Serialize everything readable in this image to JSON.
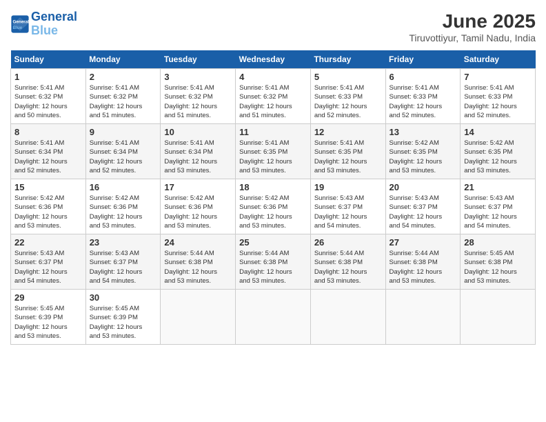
{
  "header": {
    "logo_line1": "General",
    "logo_line2": "Blue",
    "month_title": "June 2025",
    "location": "Tiruvottiyur, Tamil Nadu, India"
  },
  "weekdays": [
    "Sunday",
    "Monday",
    "Tuesday",
    "Wednesday",
    "Thursday",
    "Friday",
    "Saturday"
  ],
  "weeks": [
    [
      {
        "day": "1",
        "info": "Sunrise: 5:41 AM\nSunset: 6:32 PM\nDaylight: 12 hours\nand 50 minutes."
      },
      {
        "day": "2",
        "info": "Sunrise: 5:41 AM\nSunset: 6:32 PM\nDaylight: 12 hours\nand 51 minutes."
      },
      {
        "day": "3",
        "info": "Sunrise: 5:41 AM\nSunset: 6:32 PM\nDaylight: 12 hours\nand 51 minutes."
      },
      {
        "day": "4",
        "info": "Sunrise: 5:41 AM\nSunset: 6:32 PM\nDaylight: 12 hours\nand 51 minutes."
      },
      {
        "day": "5",
        "info": "Sunrise: 5:41 AM\nSunset: 6:33 PM\nDaylight: 12 hours\nand 52 minutes."
      },
      {
        "day": "6",
        "info": "Sunrise: 5:41 AM\nSunset: 6:33 PM\nDaylight: 12 hours\nand 52 minutes."
      },
      {
        "day": "7",
        "info": "Sunrise: 5:41 AM\nSunset: 6:33 PM\nDaylight: 12 hours\nand 52 minutes."
      }
    ],
    [
      {
        "day": "8",
        "info": "Sunrise: 5:41 AM\nSunset: 6:34 PM\nDaylight: 12 hours\nand 52 minutes."
      },
      {
        "day": "9",
        "info": "Sunrise: 5:41 AM\nSunset: 6:34 PM\nDaylight: 12 hours\nand 52 minutes."
      },
      {
        "day": "10",
        "info": "Sunrise: 5:41 AM\nSunset: 6:34 PM\nDaylight: 12 hours\nand 53 minutes."
      },
      {
        "day": "11",
        "info": "Sunrise: 5:41 AM\nSunset: 6:35 PM\nDaylight: 12 hours\nand 53 minutes."
      },
      {
        "day": "12",
        "info": "Sunrise: 5:41 AM\nSunset: 6:35 PM\nDaylight: 12 hours\nand 53 minutes."
      },
      {
        "day": "13",
        "info": "Sunrise: 5:42 AM\nSunset: 6:35 PM\nDaylight: 12 hours\nand 53 minutes."
      },
      {
        "day": "14",
        "info": "Sunrise: 5:42 AM\nSunset: 6:35 PM\nDaylight: 12 hours\nand 53 minutes."
      }
    ],
    [
      {
        "day": "15",
        "info": "Sunrise: 5:42 AM\nSunset: 6:36 PM\nDaylight: 12 hours\nand 53 minutes."
      },
      {
        "day": "16",
        "info": "Sunrise: 5:42 AM\nSunset: 6:36 PM\nDaylight: 12 hours\nand 53 minutes."
      },
      {
        "day": "17",
        "info": "Sunrise: 5:42 AM\nSunset: 6:36 PM\nDaylight: 12 hours\nand 53 minutes."
      },
      {
        "day": "18",
        "info": "Sunrise: 5:42 AM\nSunset: 6:36 PM\nDaylight: 12 hours\nand 53 minutes."
      },
      {
        "day": "19",
        "info": "Sunrise: 5:43 AM\nSunset: 6:37 PM\nDaylight: 12 hours\nand 54 minutes."
      },
      {
        "day": "20",
        "info": "Sunrise: 5:43 AM\nSunset: 6:37 PM\nDaylight: 12 hours\nand 54 minutes."
      },
      {
        "day": "21",
        "info": "Sunrise: 5:43 AM\nSunset: 6:37 PM\nDaylight: 12 hours\nand 54 minutes."
      }
    ],
    [
      {
        "day": "22",
        "info": "Sunrise: 5:43 AM\nSunset: 6:37 PM\nDaylight: 12 hours\nand 54 minutes."
      },
      {
        "day": "23",
        "info": "Sunrise: 5:43 AM\nSunset: 6:37 PM\nDaylight: 12 hours\nand 54 minutes."
      },
      {
        "day": "24",
        "info": "Sunrise: 5:44 AM\nSunset: 6:38 PM\nDaylight: 12 hours\nand 53 minutes."
      },
      {
        "day": "25",
        "info": "Sunrise: 5:44 AM\nSunset: 6:38 PM\nDaylight: 12 hours\nand 53 minutes."
      },
      {
        "day": "26",
        "info": "Sunrise: 5:44 AM\nSunset: 6:38 PM\nDaylight: 12 hours\nand 53 minutes."
      },
      {
        "day": "27",
        "info": "Sunrise: 5:44 AM\nSunset: 6:38 PM\nDaylight: 12 hours\nand 53 minutes."
      },
      {
        "day": "28",
        "info": "Sunrise: 5:45 AM\nSunset: 6:38 PM\nDaylight: 12 hours\nand 53 minutes."
      }
    ],
    [
      {
        "day": "29",
        "info": "Sunrise: 5:45 AM\nSunset: 6:39 PM\nDaylight: 12 hours\nand 53 minutes."
      },
      {
        "day": "30",
        "info": "Sunrise: 5:45 AM\nSunset: 6:39 PM\nDaylight: 12 hours\nand 53 minutes."
      },
      {
        "day": "",
        "info": ""
      },
      {
        "day": "",
        "info": ""
      },
      {
        "day": "",
        "info": ""
      },
      {
        "day": "",
        "info": ""
      },
      {
        "day": "",
        "info": ""
      }
    ]
  ]
}
